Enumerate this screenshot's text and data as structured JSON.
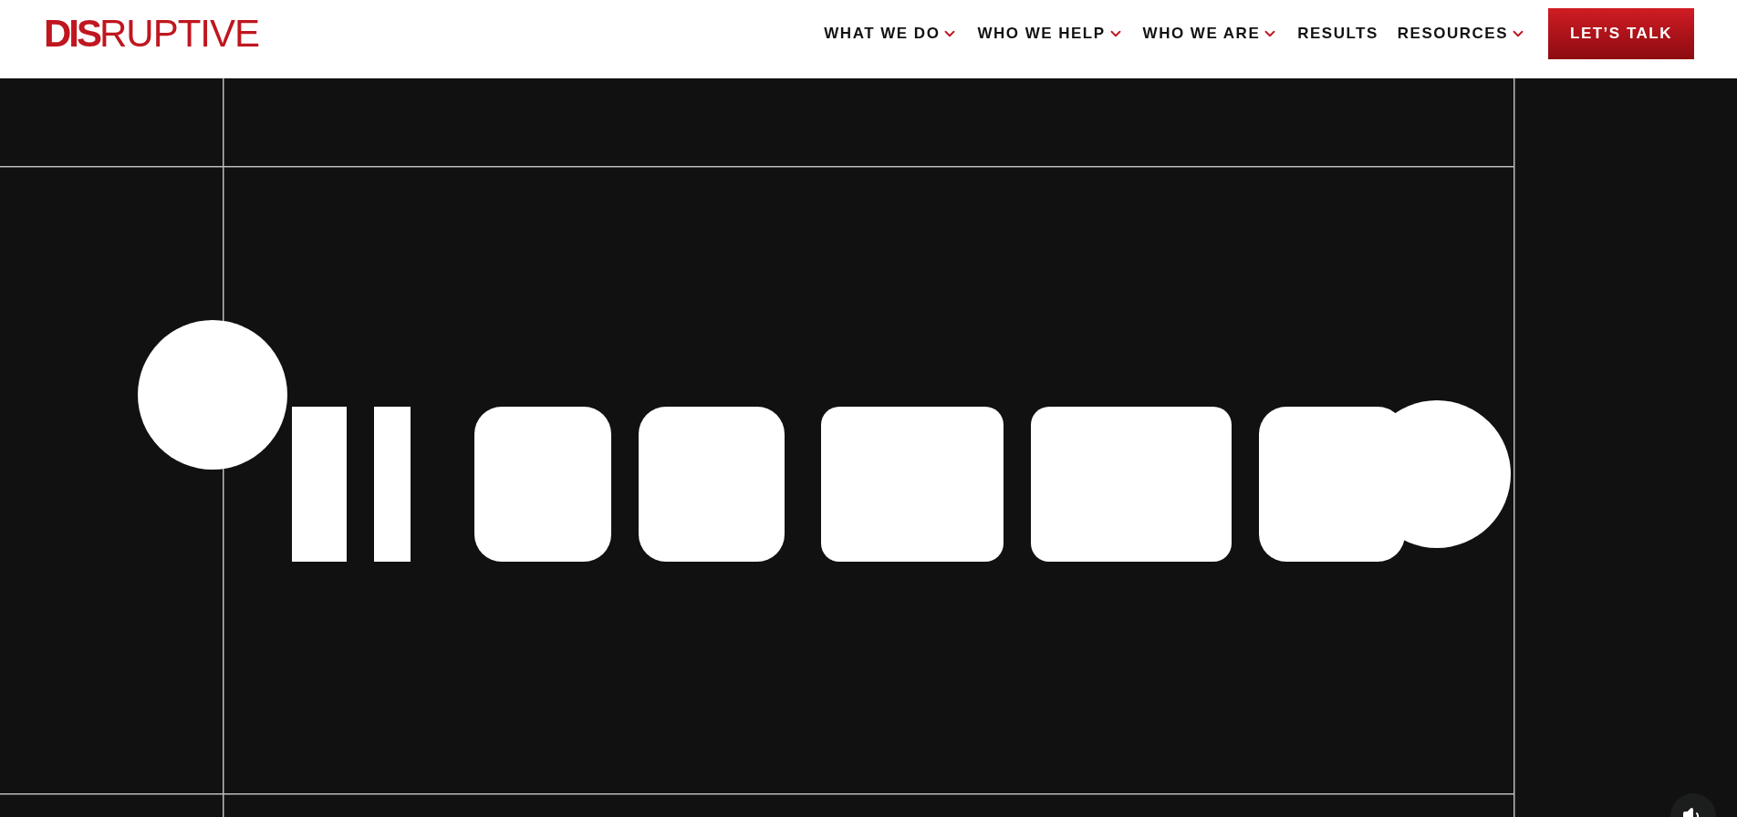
{
  "logo": {
    "bold": "DIS",
    "light": "RUPTIVE"
  },
  "nav": [
    {
      "label": "WHAT WE DO",
      "has_dropdown": true
    },
    {
      "label": "WHO WE HELP",
      "has_dropdown": true
    },
    {
      "label": "WHO WE ARE",
      "has_dropdown": true
    },
    {
      "label": "RESULTS",
      "has_dropdown": false
    },
    {
      "label": "RESOURCES",
      "has_dropdown": true
    }
  ],
  "cta": "LET’S TALK",
  "hero": {
    "kind": "picture",
    "sound_button": true
  }
}
